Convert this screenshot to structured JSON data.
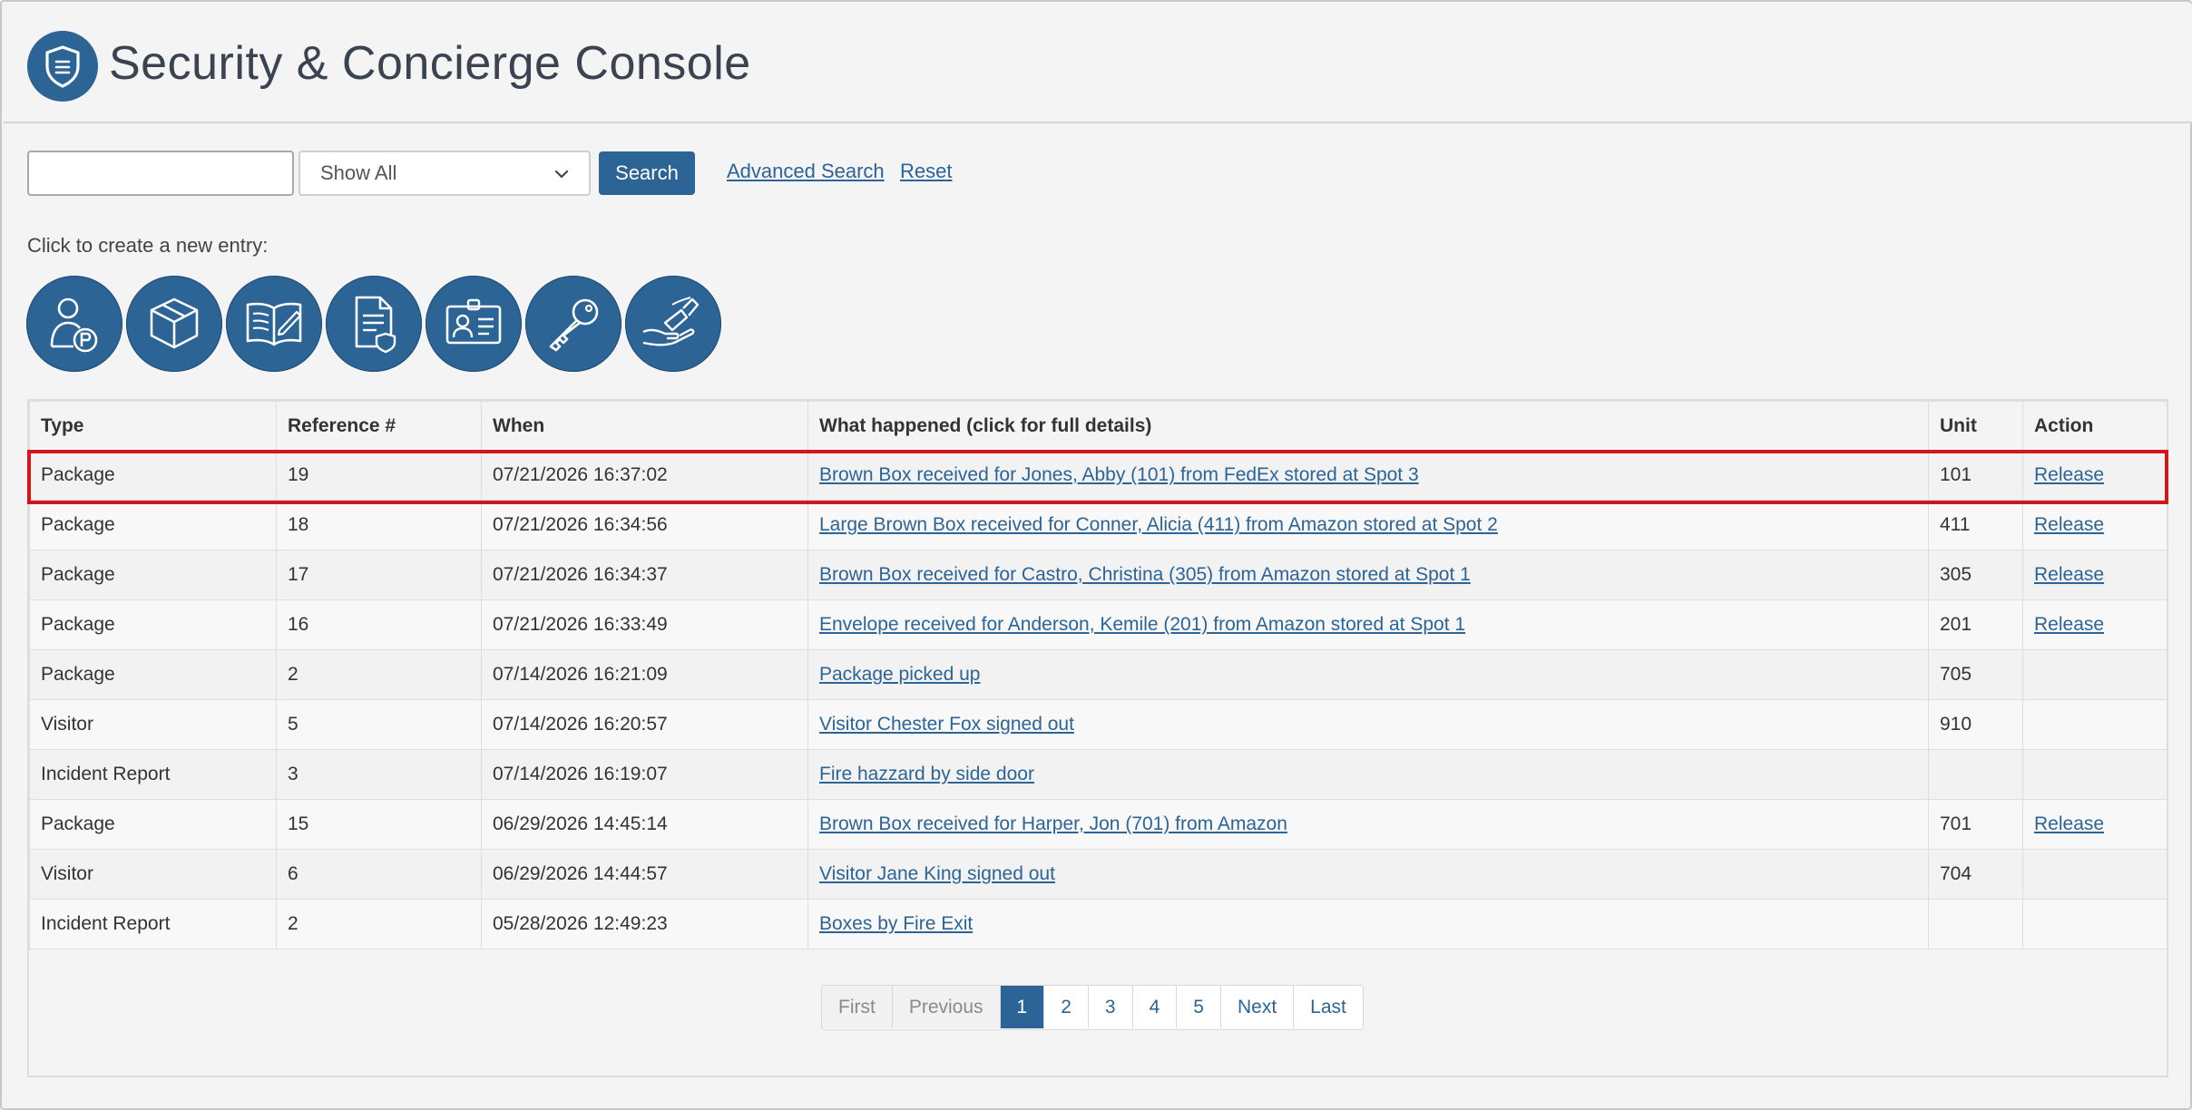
{
  "header": {
    "title": "Security & Concierge Console",
    "logo_icon": "shield-icon"
  },
  "search": {
    "input_value": "",
    "filter_selected": "Show All",
    "search_label": "Search",
    "advanced_label": "Advanced Search",
    "reset_label": "Reset"
  },
  "create": {
    "label": "Click to create a new entry:",
    "buttons": [
      {
        "icon": "visitor-parking-icon"
      },
      {
        "icon": "package-box-icon"
      },
      {
        "icon": "logbook-icon"
      },
      {
        "icon": "incident-report-icon"
      },
      {
        "icon": "id-badge-icon"
      },
      {
        "icon": "key-icon"
      },
      {
        "icon": "handover-sign-icon"
      }
    ]
  },
  "table": {
    "headers": [
      "Type",
      "Reference #",
      "When",
      "What happened (click for full details)",
      "Unit",
      "Action"
    ],
    "rows": [
      {
        "type": "Package",
        "ref": "19",
        "when": "07/21/2026 16:37:02",
        "what": "Brown Box received for Jones, Abby (101) from FedEx stored at Spot 3",
        "unit": "101",
        "action": "Release"
      },
      {
        "type": "Package",
        "ref": "18",
        "when": "07/21/2026 16:34:56",
        "what": "Large Brown Box received for Conner, Alicia (411) from Amazon stored at Spot 2",
        "unit": "411",
        "action": "Release"
      },
      {
        "type": "Package",
        "ref": "17",
        "when": "07/21/2026 16:34:37",
        "what": "Brown Box received for Castro, Christina (305) from Amazon stored at Spot 1",
        "unit": "305",
        "action": "Release"
      },
      {
        "type": "Package",
        "ref": "16",
        "when": "07/21/2026 16:33:49",
        "what": "Envelope received for Anderson, Kemile (201) from Amazon stored at Spot 1",
        "unit": "201",
        "action": "Release"
      },
      {
        "type": "Package",
        "ref": "2",
        "when": "07/14/2026 16:21:09",
        "what": "Package picked up",
        "unit": "705",
        "action": ""
      },
      {
        "type": "Visitor",
        "ref": "5",
        "when": "07/14/2026 16:20:57",
        "what": "Visitor Chester Fox signed out",
        "unit": "910",
        "action": ""
      },
      {
        "type": "Incident Report",
        "ref": "3",
        "when": "07/14/2026 16:19:07",
        "what": "Fire hazzard by side door",
        "unit": "",
        "action": ""
      },
      {
        "type": "Package",
        "ref": "15",
        "when": "06/29/2026 14:45:14",
        "what": "Brown Box received for Harper, Jon (701) from Amazon",
        "unit": "701",
        "action": "Release"
      },
      {
        "type": "Visitor",
        "ref": "6",
        "when": "06/29/2026 14:44:57",
        "what": "Visitor Jane King signed out",
        "unit": "704",
        "action": ""
      },
      {
        "type": "Incident Report",
        "ref": "2",
        "when": "05/28/2026 12:49:23",
        "what": "Boxes by Fire Exit",
        "unit": "",
        "action": ""
      }
    ]
  },
  "pagination": {
    "first": "First",
    "previous": "Previous",
    "pages": [
      "1",
      "2",
      "3",
      "4",
      "5"
    ],
    "current": "1",
    "next": "Next",
    "last": "Last"
  },
  "colors": {
    "accent": "#2c6496",
    "highlight": "#d1171b"
  }
}
